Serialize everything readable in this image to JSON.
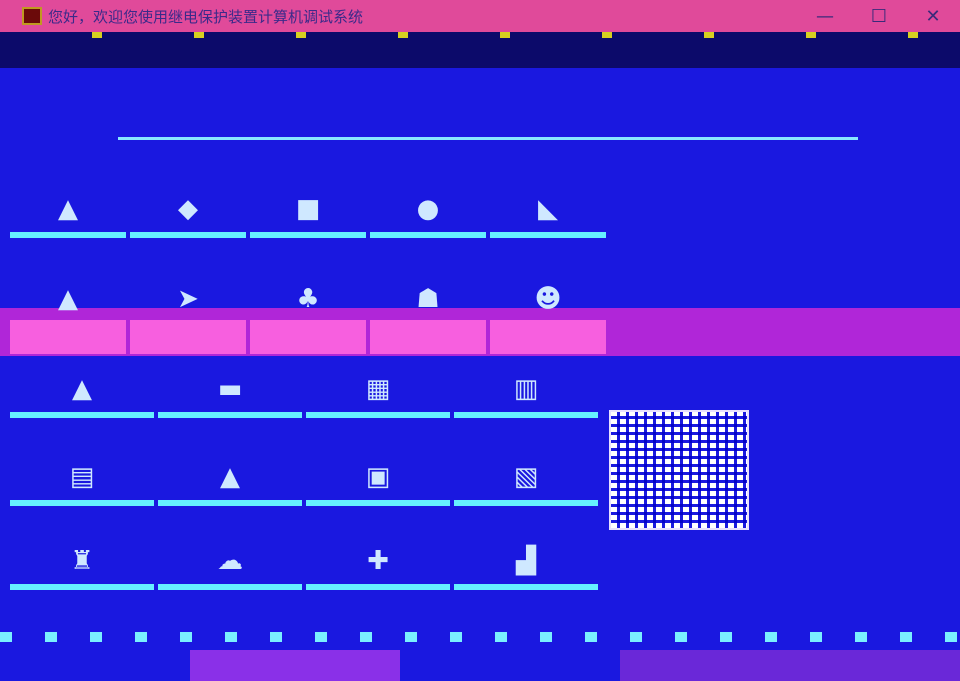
{
  "window": {
    "title": "您好，欢迎您使用继电保护装置计算机调试系统",
    "controls": {
      "minimize": "—",
      "maximize": "☐",
      "close": "✕"
    }
  },
  "header": {
    "left_text": "",
    "right_text": ""
  },
  "tiles": {
    "row1": [
      {
        "label": "",
        "icon": "tile-icon"
      },
      {
        "label": "",
        "icon": "tile-icon"
      },
      {
        "label": "",
        "icon": "tile-icon"
      },
      {
        "label": "",
        "icon": "tile-icon"
      },
      {
        "label": "",
        "icon": "tile-icon"
      }
    ],
    "row2": [
      {
        "label": "",
        "icon": "tile-icon"
      },
      {
        "label": "",
        "icon": "tile-icon"
      },
      {
        "label": "",
        "icon": "tile-icon"
      },
      {
        "label": "",
        "icon": "tile-icon"
      },
      {
        "label": "",
        "icon": "tile-icon"
      }
    ],
    "row3": [
      {
        "label": "",
        "icon": "tile-icon"
      },
      {
        "label": "",
        "icon": "tile-icon"
      },
      {
        "label": "",
        "icon": "tile-icon"
      },
      {
        "label": "",
        "icon": "tile-icon"
      }
    ],
    "row4": [
      {
        "label": "",
        "icon": "tile-icon"
      },
      {
        "label": "",
        "icon": "tile-icon"
      },
      {
        "label": "",
        "icon": "tile-icon"
      },
      {
        "label": "",
        "icon": "tile-icon"
      }
    ],
    "row5": [
      {
        "label": "",
        "icon": "tile-icon"
      },
      {
        "label": "",
        "icon": "tile-icon"
      },
      {
        "label": "",
        "icon": "tile-icon"
      },
      {
        "label": "",
        "icon": "tile-icon"
      }
    ]
  },
  "right_panel": {
    "title": ""
  },
  "status_bar": {
    "segments": [
      "",
      "",
      "",
      "",
      ""
    ]
  },
  "colors": {
    "background": "#1a18e0",
    "titlebar": "#e04a9a",
    "accent_cyan": "#66f0ff",
    "accent_magenta": "#b026d8"
  }
}
